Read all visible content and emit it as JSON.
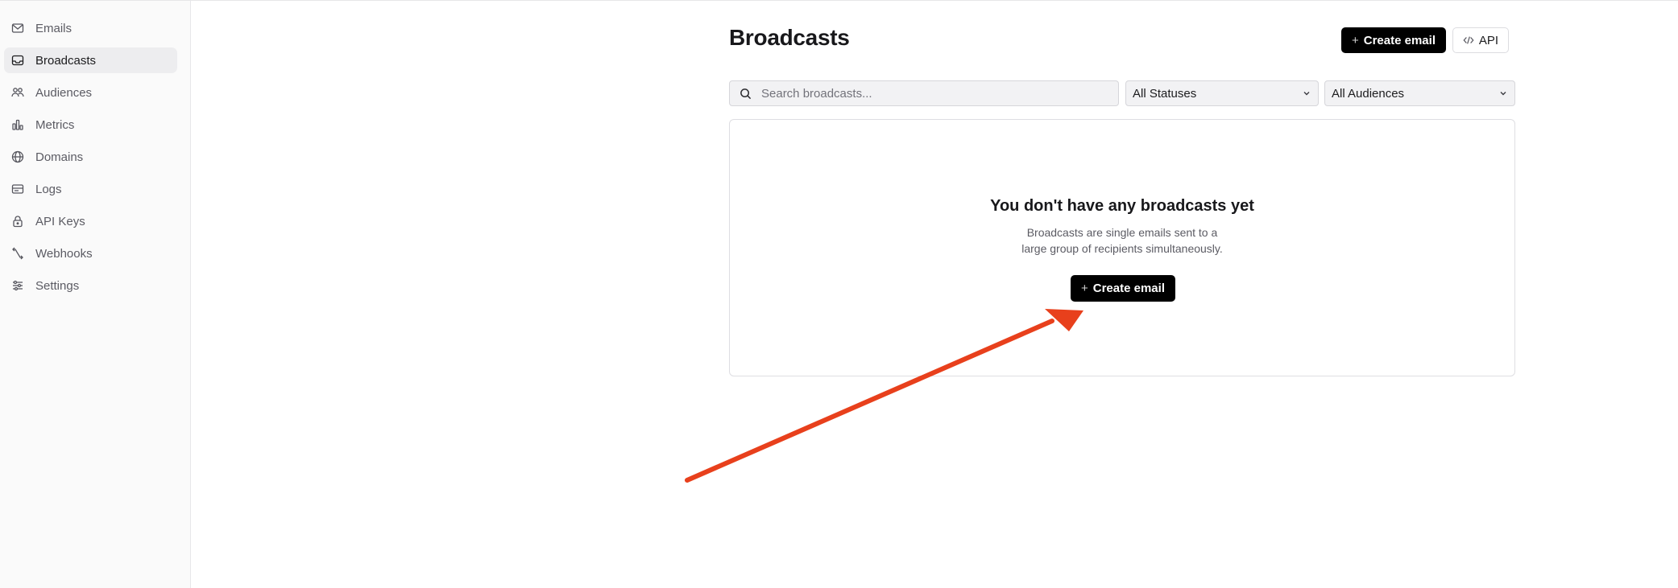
{
  "sidebar": {
    "items": [
      {
        "label": "Emails",
        "icon": "mail-icon"
      },
      {
        "label": "Broadcasts",
        "icon": "inbox-icon",
        "active": true
      },
      {
        "label": "Audiences",
        "icon": "users-icon"
      },
      {
        "label": "Metrics",
        "icon": "bar-chart-icon"
      },
      {
        "label": "Domains",
        "icon": "globe-icon"
      },
      {
        "label": "Logs",
        "icon": "logs-icon"
      },
      {
        "label": "API Keys",
        "icon": "lock-icon"
      },
      {
        "label": "Webhooks",
        "icon": "webhook-icon"
      },
      {
        "label": "Settings",
        "icon": "sliders-icon"
      }
    ]
  },
  "header": {
    "title": "Broadcasts",
    "create_label": "Create email",
    "api_label": "API"
  },
  "filters": {
    "search_placeholder": "Search broadcasts...",
    "status_value": "All Statuses",
    "audience_value": "All Audiences"
  },
  "empty_state": {
    "title": "You don't have any broadcasts yet",
    "description_line1": "Broadcasts are single emails sent to a",
    "description_line2": "large group of recipients simultaneously.",
    "create_label": "Create email"
  },
  "colors": {
    "accent_arrow": "#e8401c",
    "primary_button": "#000000",
    "sidebar_bg": "#fafafa",
    "active_item_bg": "#ededef"
  }
}
